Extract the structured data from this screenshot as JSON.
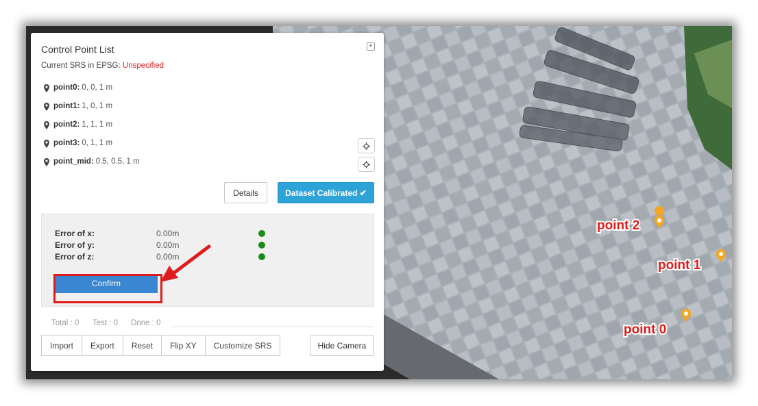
{
  "panel": {
    "title": "Control Point List",
    "srs_prefix": "Current SRS in EPSG:",
    "srs_value": "Unspecified",
    "points": [
      {
        "name": "point0:",
        "value": "0, 0, 1 m"
      },
      {
        "name": "point1:",
        "value": "1, 0, 1 m"
      },
      {
        "name": "point2:",
        "value": "1, 1, 1 m"
      },
      {
        "name": "point3:",
        "value": "0, 1, 1 m"
      },
      {
        "name": "point_mid:",
        "value": "0.5, 0.5, 1 m"
      }
    ],
    "details_label": "Details",
    "calibrated_label": "Dataset Calibrated ✔",
    "errors": [
      {
        "label": "Error of x:",
        "value": "0.00m"
      },
      {
        "label": "Error of y:",
        "value": "0.00m"
      },
      {
        "label": "Error of z:",
        "value": "0.00m"
      }
    ],
    "confirm_label": "Confirm",
    "stats": {
      "total": "Total : 0",
      "test": "Test : 0",
      "done": "Done : 0"
    },
    "buttons": [
      "Import",
      "Export",
      "Reset",
      "Flip XY",
      "Customize SRS"
    ],
    "hide_camera_label": "Hide Camera"
  },
  "map": {
    "markers": [
      {
        "label": "point 2"
      },
      {
        "label": "point 1"
      },
      {
        "label": "point 0"
      }
    ]
  },
  "colors": {
    "accent": "#2ea3d8",
    "confirm": "#3a86d0",
    "unspecified": "#e02020",
    "ok_dot": "#1a8a1a",
    "highlight": "#e01b1b",
    "marker": "#f5a623"
  }
}
